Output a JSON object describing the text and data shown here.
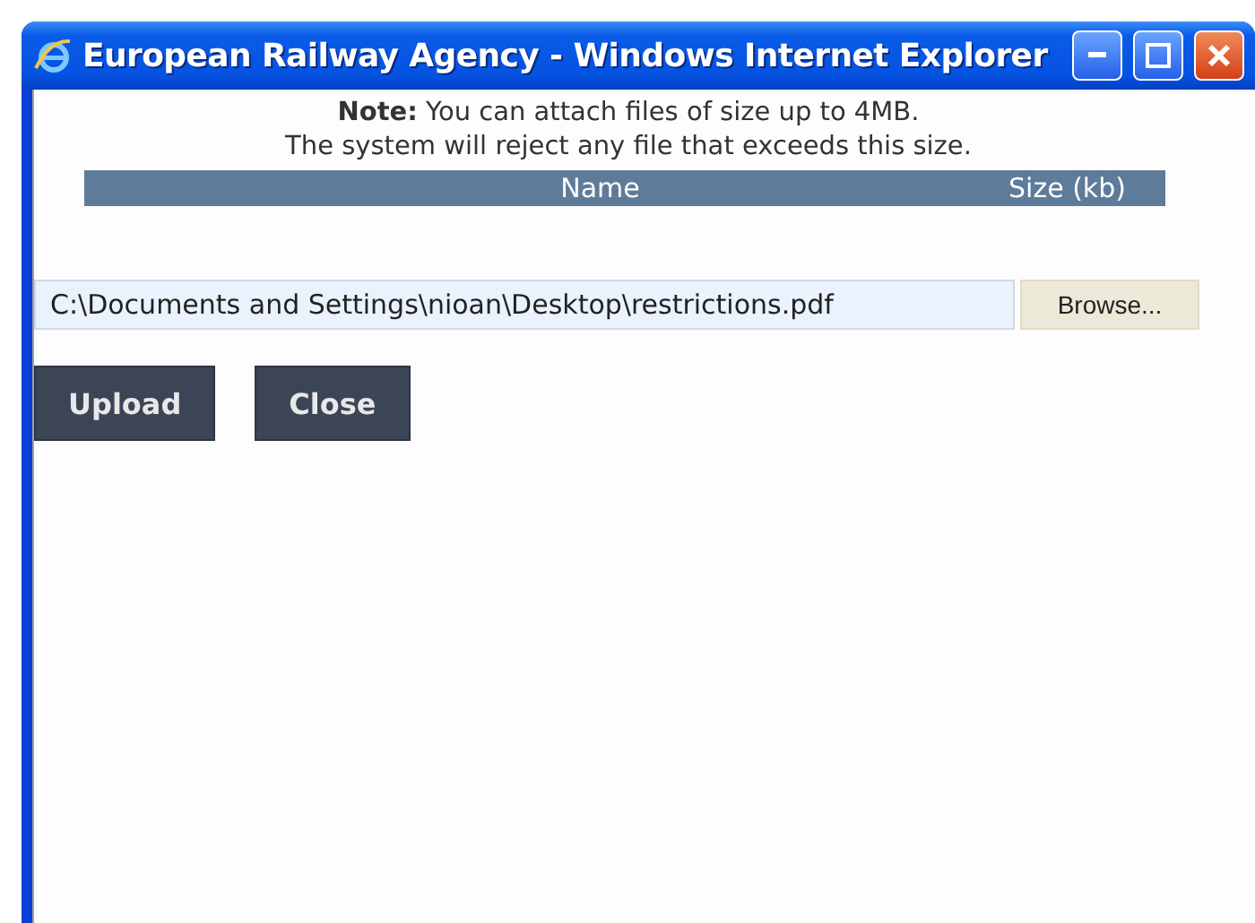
{
  "window": {
    "title": "European Railway Agency - Windows Internet Explorer"
  },
  "note": {
    "text": "**Note:** You can attach files of size up to 4MB.",
    "subtext": "The system will reject any file that exceeds this size."
  },
  "table": {
    "columns": [
      "Name",
      "Size (kb)"
    ]
  },
  "file_field": {
    "value": "C:\\Documents and Settings\\nioan\\Desktop\\restrictions.pdf"
  },
  "browse_button": "Browse...",
  "buttons": [
    "Upload",
    "Close"
  ]
}
